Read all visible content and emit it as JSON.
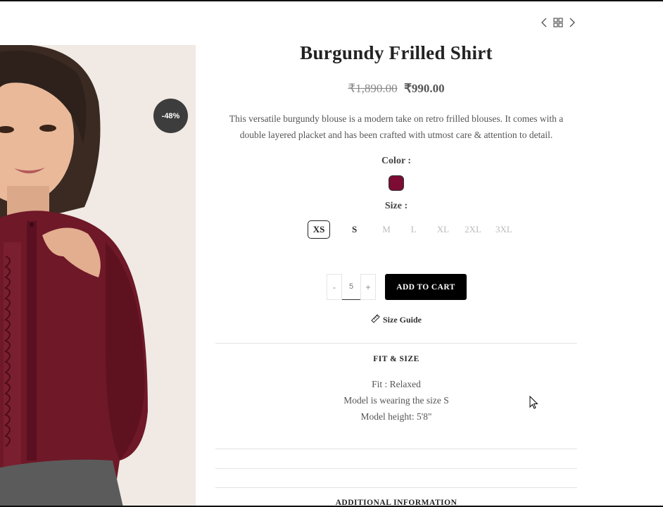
{
  "product": {
    "discount_badge": "-48%",
    "title": "Burgundy Frilled Shirt",
    "price_old": "₹1,890.00",
    "price_new": "₹990.00",
    "description_line1": "This versatile burgundy blouse is a modern take on retro frilled blouses. It comes with a",
    "description_line2": "double layered placket and has been crafted with utmost care & attention to detail."
  },
  "nav": {
    "prev_icon": "chevron-left-icon",
    "grid_icon": "grid-icon",
    "next_icon": "chevron-right-icon"
  },
  "color": {
    "label": "Color :",
    "swatch_color": "#7d0c35"
  },
  "size": {
    "label": "Size :",
    "options": [
      "XS",
      "S",
      "M",
      "L",
      "XL",
      "2XL",
      "3XL"
    ],
    "selected": "XS"
  },
  "quantity": {
    "minus": "-",
    "value": "5",
    "plus": "+"
  },
  "cart": {
    "add_label": "ADD TO CART"
  },
  "size_guide": {
    "label": "Size Guide",
    "icon": "ruler-icon"
  },
  "fit_size": {
    "title": "FIT & SIZE",
    "line1": "Fit : Relaxed",
    "line2": "Model is wearing the size S",
    "line3": "Model height: 5'8\""
  },
  "additional": {
    "title": "ADDITIONAL INFORMATION"
  }
}
